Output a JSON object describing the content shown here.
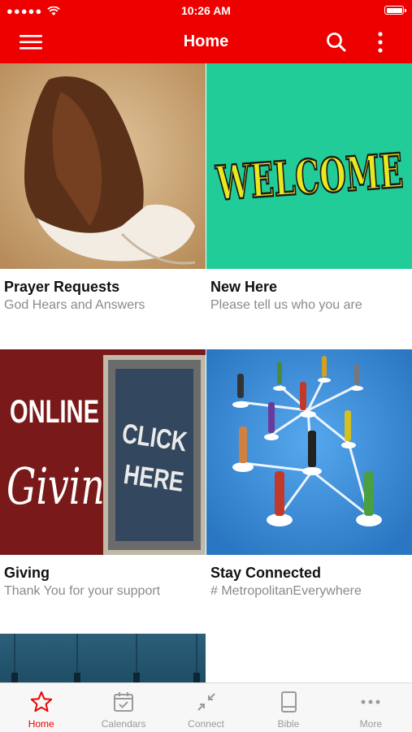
{
  "status_bar": {
    "signal_dots": "●●●●●",
    "time": "10:26 AM"
  },
  "nav": {
    "title": "Home",
    "menu_icon": "hamburger-icon",
    "search_icon": "search-icon",
    "more_icon": "more-vertical-icon"
  },
  "tiles": [
    {
      "title": "Prayer Requests",
      "subtitle": "God Hears and Answers",
      "image": "praying-hands"
    },
    {
      "title": "New Here",
      "subtitle": "Please tell us who you are",
      "image_text": "WELCOME"
    },
    {
      "title": "Giving",
      "subtitle": "Thank You for your support",
      "image_text_1": "ONLINE",
      "image_text_2": "Giving",
      "image_text_3": "CLICK",
      "image_text_4": "HERE"
    },
    {
      "title": "Stay Connected",
      "subtitle": "# MetropolitanEverywhere",
      "image": "network-of-people"
    }
  ],
  "tabs": [
    {
      "label": "Home",
      "icon": "star-icon",
      "active": true
    },
    {
      "label": "Calendars",
      "icon": "calendar-icon",
      "active": false
    },
    {
      "label": "Connect",
      "icon": "connect-arrows-icon",
      "active": false
    },
    {
      "label": "Bible",
      "icon": "book-icon",
      "active": false
    },
    {
      "label": "More",
      "icon": "more-horizontal-icon",
      "active": false
    }
  ],
  "colors": {
    "brand": "#ee0000",
    "welcome_bg": "#22cc99",
    "connect_bg": "#3a8fd8"
  }
}
